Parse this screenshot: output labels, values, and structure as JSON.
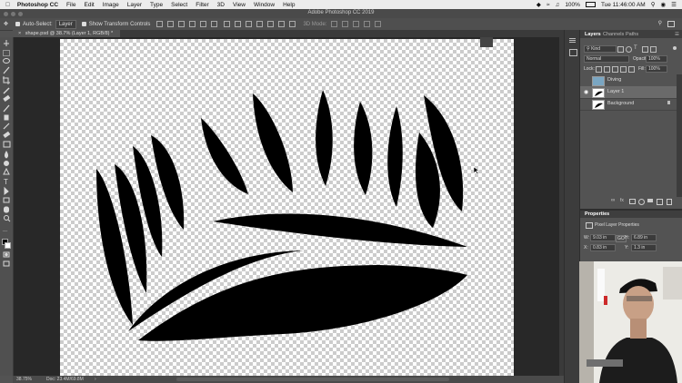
{
  "menubar": {
    "app": "Photoshop CC",
    "items": [
      "File",
      "Edit",
      "Image",
      "Layer",
      "Type",
      "Select",
      "Filter",
      "3D",
      "View",
      "Window",
      "Help"
    ],
    "battery": "100%",
    "clock": "Tue 11:46:00 AM"
  },
  "window": {
    "title": "Adobe Photoshop CC 2019"
  },
  "options": {
    "auto_select_label": "Auto-Select:",
    "auto_select_value": "Layer",
    "transform_label": "Show Transform Controls",
    "mode_label": "3D Mode:"
  },
  "document": {
    "tab_title": "shape.psd @ 38.7% (Layer 1, RGB/8) *",
    "zoom": "38.75%",
    "doc_info": "Doc: 23.4M/69.8M"
  },
  "layers_panel": {
    "tabs": [
      "Layers",
      "Channels",
      "Paths"
    ],
    "filter_value": "Kind",
    "blend_mode": "Normal",
    "opacity_label": "Opacity:",
    "opacity_value": "100%",
    "lock_label": "Lock:",
    "fill_label": "Fill:",
    "fill_value": "100%",
    "layers": [
      {
        "name": "Diving",
        "visible": false,
        "selected": false
      },
      {
        "name": "Layer 1",
        "visible": true,
        "selected": true
      },
      {
        "name": "Background",
        "visible": false,
        "selected": false
      }
    ]
  },
  "properties_panel": {
    "title": "Properties",
    "subtitle": "Pixel Layer Properties",
    "w_label": "W:",
    "w_value": "9.03 in",
    "go_label": "GO",
    "h_label": "H:",
    "h_value": "6.89 in",
    "x_label": "X:",
    "x_value": "0.83 in",
    "y_label": "Y:",
    "y_value": "1.3 in"
  }
}
